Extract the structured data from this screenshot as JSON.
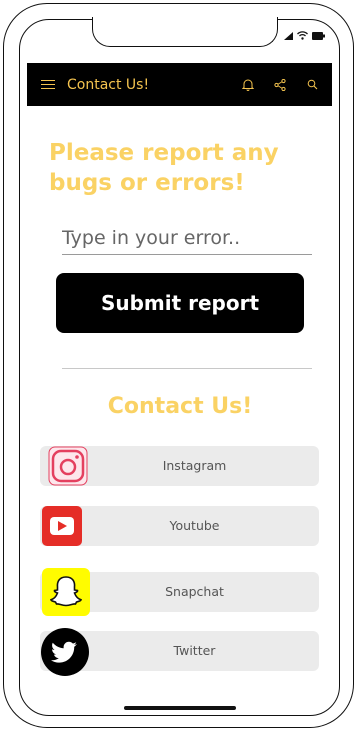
{
  "appbar": {
    "title": "Contact Us!",
    "menu_icon": "hamburger-menu-icon",
    "actions": [
      "bell-icon",
      "share-icon",
      "search-icon"
    ]
  },
  "report": {
    "heading": "Please report any bugs or errors!",
    "input_placeholder": "Type in your error..",
    "input_value": "",
    "submit_label": "Submit report"
  },
  "contact": {
    "heading": "Contact Us!",
    "items": [
      {
        "label": "Instagram",
        "icon": "instagram-icon"
      },
      {
        "label": "Youtube",
        "icon": "youtube-icon"
      },
      {
        "label": "Snapchat",
        "icon": "snapchat-icon"
      },
      {
        "label": "Twitter",
        "icon": "twitter-icon"
      }
    ]
  },
  "colors": {
    "accent": "#fad264",
    "appbar_bg": "#000000",
    "row_bg": "#ebebeb",
    "youtube": "#e52d27",
    "snapchat": "#fffc00",
    "instagram": "#e4405f"
  }
}
